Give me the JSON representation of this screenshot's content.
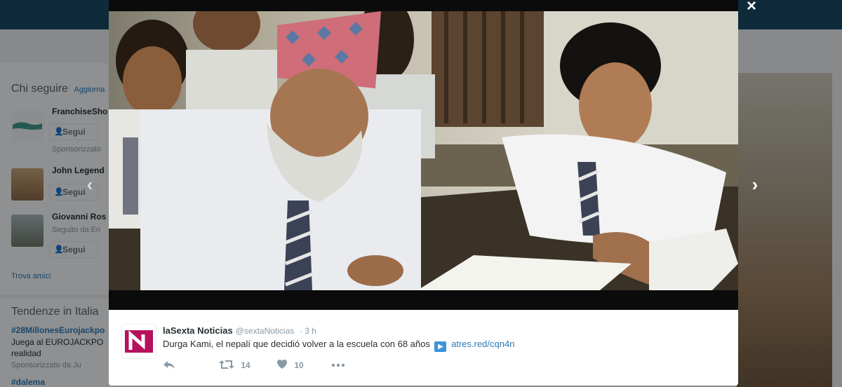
{
  "sidebar": {
    "who_to_follow_title": "Chi seguire",
    "refresh_label": "Aggiorna",
    "follow_label": "Segui",
    "users": [
      {
        "name": "FranchiseSho",
        "sub": "",
        "promo": "Sponsorizzato"
      },
      {
        "name": "John Legend",
        "sub": "",
        "promo": ""
      },
      {
        "name": "Giovanni Ros",
        "sub": "Seguito da En",
        "promo": ""
      }
    ],
    "find_friends": "Trova amici",
    "trends_title": "Tendenze in Italia",
    "trends": [
      {
        "tag": "#28MillonesEurojackpo",
        "text": "Juega al EUROJACKPO",
        "text2": "realidad",
        "promo": "Sponsorizzato da Ju"
      },
      {
        "tag": "#dalema"
      }
    ]
  },
  "modal": {
    "close_glyph": "×",
    "prev_glyph": "‹",
    "next_glyph": "›",
    "tweet": {
      "author_name": "laSexta Noticias",
      "handle": "@sextaNoticias",
      "time": "· 3 h",
      "text": "Durga Kami, el nepalí que decidió volver a la escuela con 68 años",
      "link": "atres.red/cqn4n",
      "retweets": "14",
      "likes": "10"
    }
  },
  "colors": {
    "topbar": "#1b4a66",
    "link": "#2b7bb9",
    "avatar_brand": "#b5115c"
  }
}
